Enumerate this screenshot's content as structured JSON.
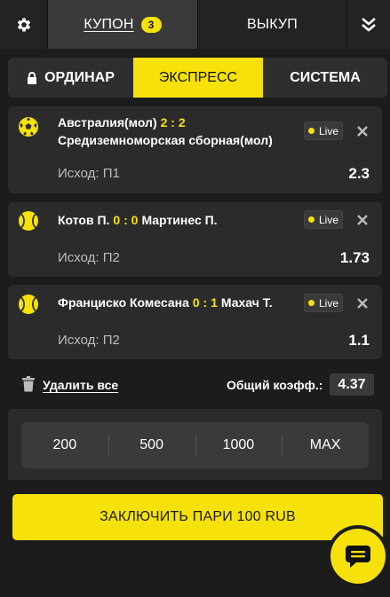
{
  "header": {
    "coupon_label": "КУПОН",
    "coupon_count": "3",
    "buyout_label": "ВЫКУП",
    "icons": {
      "settings": "gear-icon",
      "collapse": "double-chevron-down-icon"
    }
  },
  "bet_types": {
    "single": "ОРДИНАР",
    "express": "ЭКСПРЕСС",
    "system": "СИСТЕМА",
    "selected": "express"
  },
  "bets": [
    {
      "sport": "football",
      "team1": "Австралия(мол)",
      "score": "2 : 2",
      "team2": "Средиземноморская сборная(мол)",
      "live": "Live",
      "outcome_label": "Исход:",
      "outcome": "П1",
      "odd": "2.3"
    },
    {
      "sport": "tennis",
      "team1": "Котов П.",
      "score": "0 : 0",
      "team2": "Мартинес П.",
      "live": "Live",
      "outcome_label": "Исход:",
      "outcome": "П2",
      "odd": "1.73"
    },
    {
      "sport": "tennis",
      "team1": "Франциско Комесана",
      "score": "0 : 1",
      "team2": "Махач Т.",
      "live": "Live",
      "outcome_label": "Исход:",
      "outcome": "П2",
      "odd": "1.1"
    }
  ],
  "summary": {
    "delete_all": "Удалить все",
    "total_label": "Общий коэфф.:",
    "total_value": "4.37"
  },
  "stakes": [
    "200",
    "500",
    "1000",
    "MAX"
  ],
  "place_bet": "ЗАКЛЮЧИТЬ ПАРИ 100 RUB",
  "colors": {
    "accent": "#f6e20a",
    "background": "#1c1c1c",
    "card": "#2b2b2b"
  }
}
